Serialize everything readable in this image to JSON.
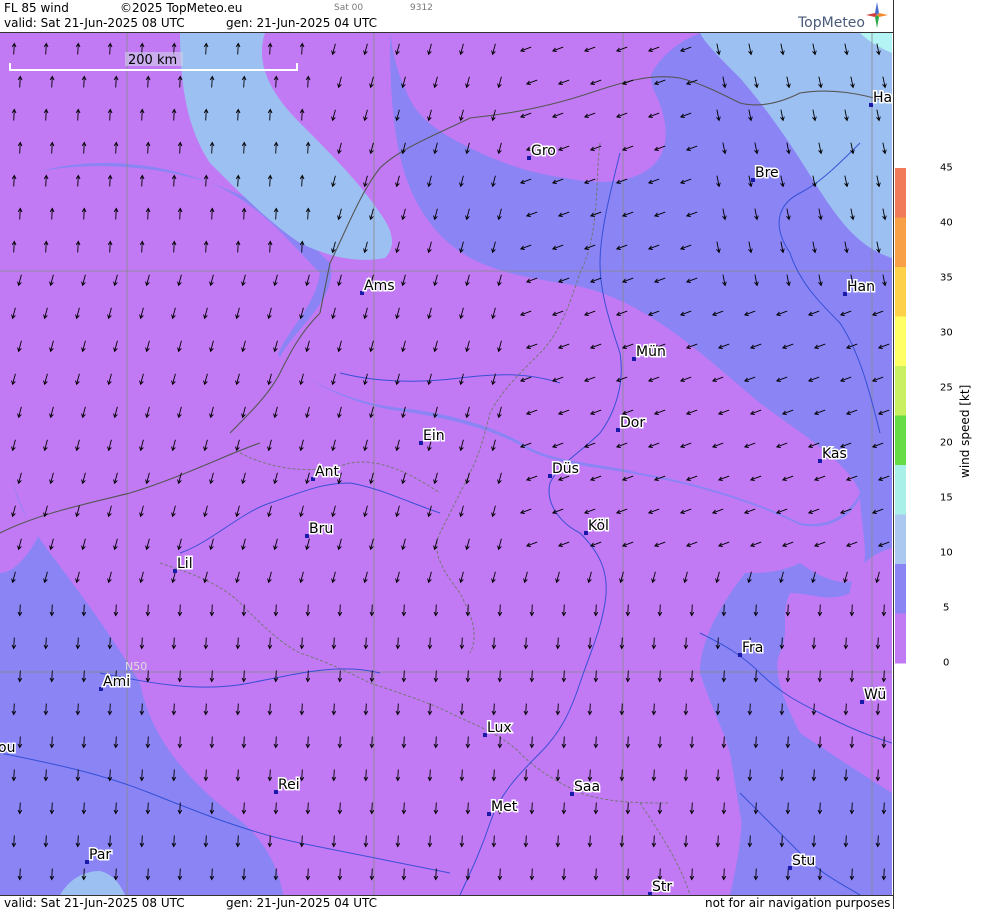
{
  "header": {
    "title": "FL 85 wind",
    "copyright": "©2025 TopMeteo.eu",
    "valid": "valid:  Sat  21-Jun-2025  08 UTC",
    "gen": "gen: 21-Jun-2025 04 UTC",
    "sat": "Sat 00",
    "code": "9312",
    "logo": "TopMeteo"
  },
  "footer": {
    "valid": "valid:  Sat  21-Jun-2025  08 UTC",
    "gen": "gen: 21-Jun-2025 04 UTC",
    "disclaimer": "not for air navigation purposes"
  },
  "map": {
    "scale_bar_label": "200 km",
    "lat_label": "N50",
    "cities": [
      {
        "name": "Gro"
      },
      {
        "name": "Bre"
      },
      {
        "name": "Ha"
      },
      {
        "name": "Ams"
      },
      {
        "name": "Han"
      },
      {
        "name": "Mün"
      },
      {
        "name": "Ein"
      },
      {
        "name": "Dor"
      },
      {
        "name": "Kas"
      },
      {
        "name": "Ant"
      },
      {
        "name": "Düs"
      },
      {
        "name": "Köl"
      },
      {
        "name": "Bru"
      },
      {
        "name": "Lil"
      },
      {
        "name": "Fra"
      },
      {
        "name": "Ami"
      },
      {
        "name": "Wü"
      },
      {
        "name": "ou"
      },
      {
        "name": "Lux"
      },
      {
        "name": "Rei"
      },
      {
        "name": "Saa"
      },
      {
        "name": "Met"
      },
      {
        "name": "Par"
      },
      {
        "name": "Stu"
      },
      {
        "name": "Str"
      }
    ]
  },
  "legend": {
    "title": "wind  speed  [kt]",
    "ticks": [
      "45",
      "40",
      "35",
      "30",
      "25",
      "20",
      "15",
      "10",
      "5",
      "0"
    ],
    "colors": [
      "#f07a5a",
      "#f7a048",
      "#fdd14a",
      "#ffff66",
      "#c8f060",
      "#66dd44",
      "#a8f0e8",
      "#aac8f0",
      "#8a84f5",
      "#c17af4"
    ]
  },
  "colors": {
    "lilac": "#c17af4",
    "blue_violet": "#8a84f5",
    "light_blue": "#9dc0f2",
    "cyan": "#b4f4f4",
    "marker": "#1a1aa8"
  }
}
